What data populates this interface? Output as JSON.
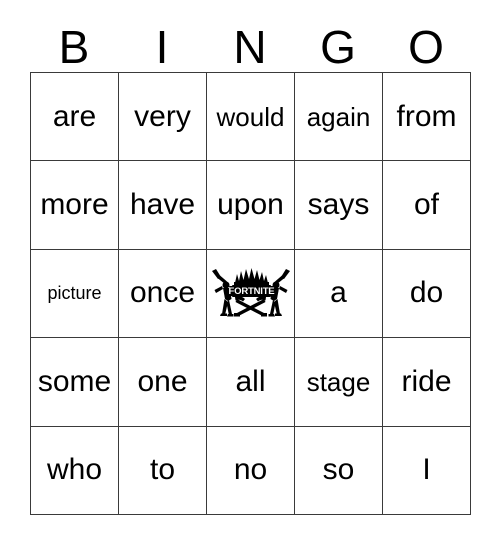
{
  "card": {
    "headers": [
      "B",
      "I",
      "N",
      "G",
      "O"
    ],
    "rows": [
      [
        {
          "text": "are",
          "size": "md"
        },
        {
          "text": "very",
          "size": "md"
        },
        {
          "text": "would",
          "size": "sm"
        },
        {
          "text": "again",
          "size": "sm"
        },
        {
          "text": "from",
          "size": "md"
        }
      ],
      [
        {
          "text": "more",
          "size": "md"
        },
        {
          "text": "have",
          "size": "md"
        },
        {
          "text": "upon",
          "size": "md"
        },
        {
          "text": "says",
          "size": "md"
        },
        {
          "text": "of",
          "size": "md"
        }
      ],
      [
        {
          "text": "picture",
          "size": "xs"
        },
        {
          "text": "once",
          "size": "md"
        },
        {
          "text": "",
          "size": "md",
          "icon": "fortnite-logo"
        },
        {
          "text": "a",
          "size": "md"
        },
        {
          "text": "do",
          "size": "md"
        }
      ],
      [
        {
          "text": "some",
          "size": "md"
        },
        {
          "text": "one",
          "size": "md"
        },
        {
          "text": "all",
          "size": "md"
        },
        {
          "text": "stage",
          "size": "sm"
        },
        {
          "text": "ride",
          "size": "md"
        }
      ],
      [
        {
          "text": "who",
          "size": "md"
        },
        {
          "text": "to",
          "size": "md"
        },
        {
          "text": "no",
          "size": "md"
        },
        {
          "text": "so",
          "size": "md"
        },
        {
          "text": "I",
          "size": "md"
        }
      ]
    ],
    "free_space": {
      "icon": "fortnite-logo",
      "banner_text": "FORTNITE"
    },
    "colors": {
      "background": "#ffffff",
      "text": "#000000",
      "grid_line": "#3a3a3a"
    }
  }
}
